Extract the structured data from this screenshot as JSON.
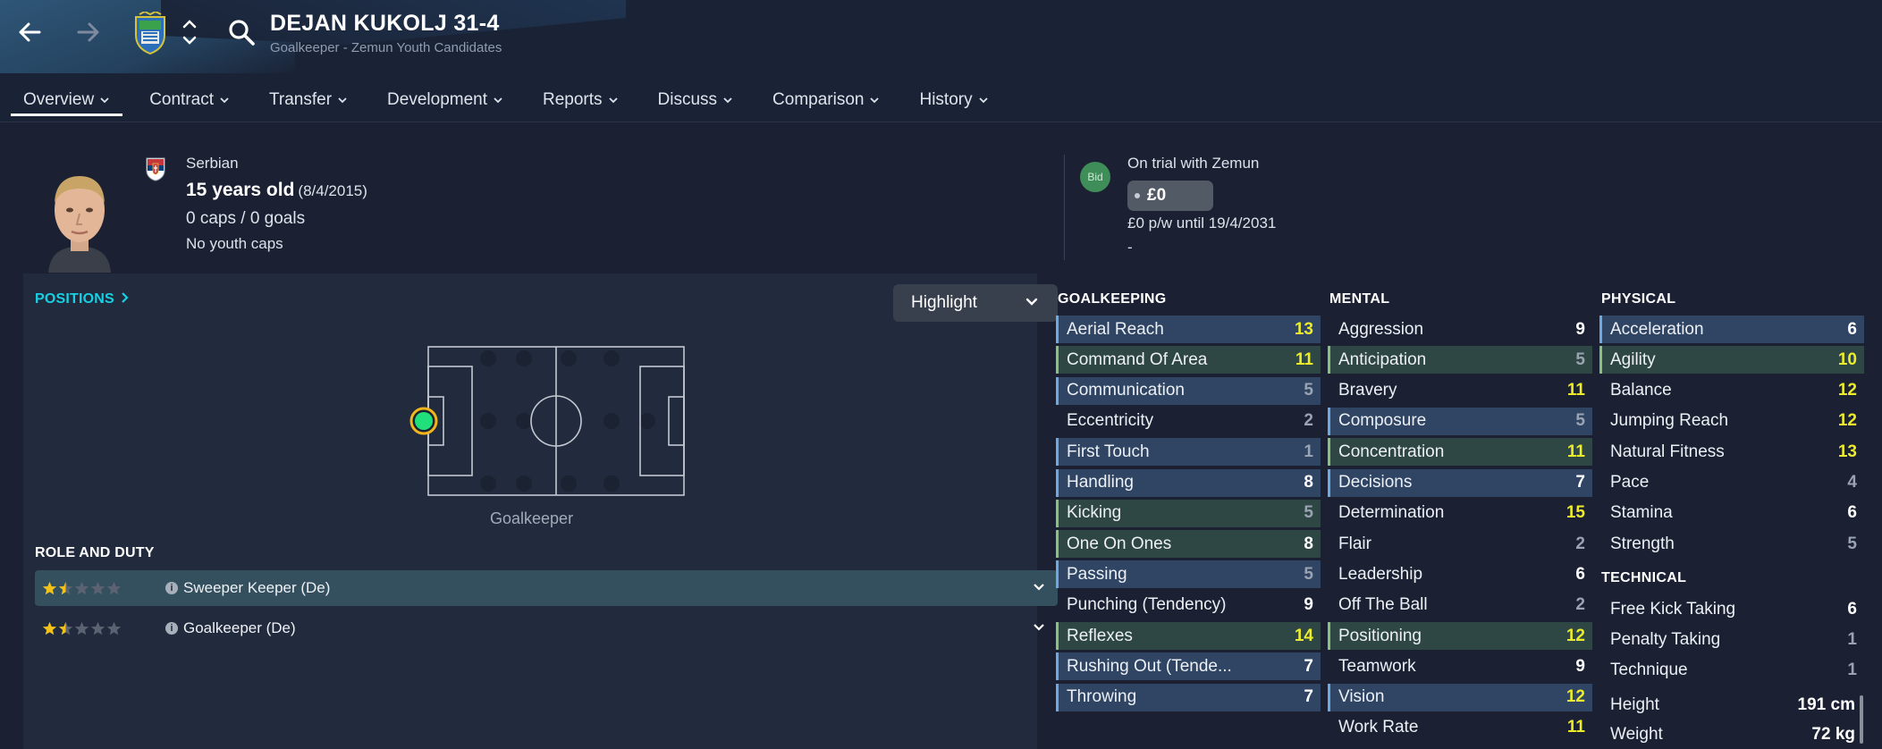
{
  "header": {
    "player_name": "DEJAN KUKOLJ 31-4",
    "subtitle": "Goalkeeper - Zemun Youth Candidates",
    "tabs": [
      {
        "label": "Overview",
        "active": true
      },
      {
        "label": "Contract"
      },
      {
        "label": "Transfer"
      },
      {
        "label": "Development"
      },
      {
        "label": "Reports"
      },
      {
        "label": "Discuss"
      },
      {
        "label": "Comparison"
      },
      {
        "label": "History"
      }
    ]
  },
  "bio": {
    "nationality": "Serbian",
    "age": "15 years old",
    "dob": "(8/4/2015)",
    "caps": "0 caps / 0 goals",
    "youth_caps": "No youth caps"
  },
  "status": {
    "bid_label": "Bid",
    "trial": "On trial with Zemun",
    "value": "£0",
    "wage": "£0 p/w until 19/4/2031",
    "extra": "-"
  },
  "positions": {
    "link_label": "POSITIONS",
    "highlight_label": "Highlight",
    "position_label": "Goalkeeper"
  },
  "roles": {
    "title": "ROLE AND DUTY",
    "items": [
      {
        "name": "Sweeper Keeper (De)",
        "stars": 1.5,
        "selected": true
      },
      {
        "name": "Goalkeeper (De)",
        "stars": 1.5
      }
    ]
  },
  "goalkeeping": {
    "title": "GOALKEEPING",
    "attrs": [
      {
        "name": "Aerial Reach",
        "value": 13,
        "hl": "blue"
      },
      {
        "name": "Command Of Area",
        "value": 11,
        "hl": "green"
      },
      {
        "name": "Communication",
        "value": 5,
        "hl": "blue"
      },
      {
        "name": "Eccentricity",
        "value": 2,
        "hl": ""
      },
      {
        "name": "First Touch",
        "value": 1,
        "hl": "blue"
      },
      {
        "name": "Handling",
        "value": 8,
        "hl": "blue"
      },
      {
        "name": "Kicking",
        "value": 5,
        "hl": "green"
      },
      {
        "name": "One On Ones",
        "value": 8,
        "hl": "green"
      },
      {
        "name": "Passing",
        "value": 5,
        "hl": "blue"
      },
      {
        "name": "Punching (Tendency)",
        "value": 9,
        "hl": ""
      },
      {
        "name": "Reflexes",
        "value": 14,
        "hl": "green"
      },
      {
        "name": "Rushing Out (Tende...",
        "value": 7,
        "hl": "blue"
      },
      {
        "name": "Throwing",
        "value": 7,
        "hl": "blue"
      }
    ]
  },
  "mental": {
    "title": "MENTAL",
    "attrs": [
      {
        "name": "Aggression",
        "value": 9,
        "hl": ""
      },
      {
        "name": "Anticipation",
        "value": 5,
        "hl": "green"
      },
      {
        "name": "Bravery",
        "value": 11,
        "hl": ""
      },
      {
        "name": "Composure",
        "value": 5,
        "hl": "blue"
      },
      {
        "name": "Concentration",
        "value": 11,
        "hl": "green"
      },
      {
        "name": "Decisions",
        "value": 7,
        "hl": "blue"
      },
      {
        "name": "Determination",
        "value": 15,
        "hl": ""
      },
      {
        "name": "Flair",
        "value": 2,
        "hl": ""
      },
      {
        "name": "Leadership",
        "value": 6,
        "hl": ""
      },
      {
        "name": "Off The Ball",
        "value": 2,
        "hl": ""
      },
      {
        "name": "Positioning",
        "value": 12,
        "hl": "green"
      },
      {
        "name": "Teamwork",
        "value": 9,
        "hl": ""
      },
      {
        "name": "Vision",
        "value": 12,
        "hl": "blue"
      },
      {
        "name": "Work Rate",
        "value": 11,
        "hl": ""
      }
    ]
  },
  "physical": {
    "title": "PHYSICAL",
    "attrs": [
      {
        "name": "Acceleration",
        "value": 6,
        "hl": "blue"
      },
      {
        "name": "Agility",
        "value": 10,
        "hl": "green"
      },
      {
        "name": "Balance",
        "value": 12,
        "hl": ""
      },
      {
        "name": "Jumping Reach",
        "value": 12,
        "hl": ""
      },
      {
        "name": "Natural Fitness",
        "value": 13,
        "hl": ""
      },
      {
        "name": "Pace",
        "value": 4,
        "hl": ""
      },
      {
        "name": "Stamina",
        "value": 6,
        "hl": ""
      },
      {
        "name": "Strength",
        "value": 5,
        "hl": ""
      }
    ]
  },
  "technical": {
    "title": "TECHNICAL",
    "attrs": [
      {
        "name": "Free Kick Taking",
        "value": 6,
        "hl": ""
      },
      {
        "name": "Penalty Taking",
        "value": 1,
        "hl": ""
      },
      {
        "name": "Technique",
        "value": 1,
        "hl": ""
      }
    ]
  },
  "body": {
    "height_label": "Height",
    "height": "191 cm",
    "weight_label": "Weight",
    "weight": "72 kg"
  },
  "colors": {
    "accent_cyan": "#18d0e3",
    "high_value": "#ecec2a",
    "bid_green": "#3f8d58",
    "highlight_blue": "#2f4563",
    "highlight_green": "#2f4744"
  }
}
